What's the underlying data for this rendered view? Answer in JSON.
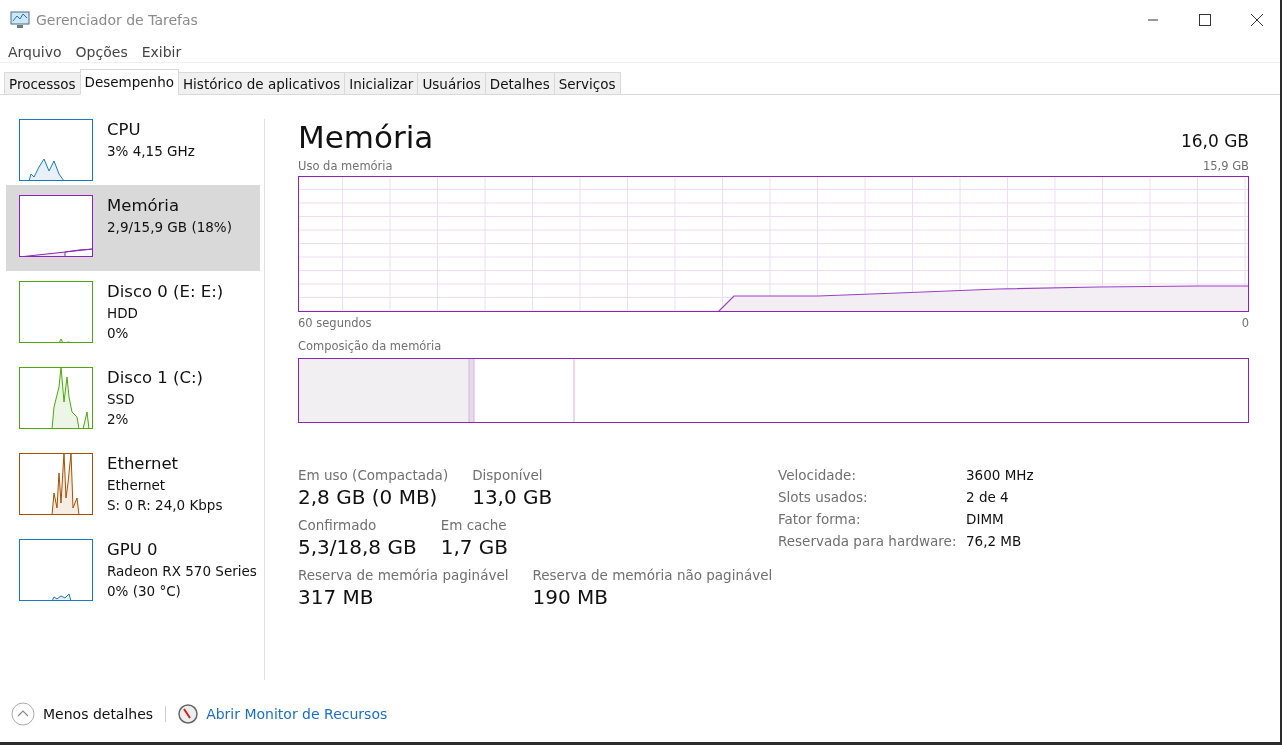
{
  "window": {
    "title": "Gerenciador de Tarefas"
  },
  "menu": [
    "Arquivo",
    "Opções",
    "Exibir"
  ],
  "tabs": [
    {
      "label": "Processos",
      "selected": false
    },
    {
      "label": "Desempenho",
      "selected": true
    },
    {
      "label": "Histórico de aplicativos",
      "selected": false
    },
    {
      "label": "Inicializar",
      "selected": false
    },
    {
      "label": "Usuários",
      "selected": false
    },
    {
      "label": "Detalhes",
      "selected": false
    },
    {
      "label": "Serviços",
      "selected": false
    }
  ],
  "sidebar": {
    "items": [
      {
        "name": "CPU",
        "lines": [
          "3% 4,15 GHz"
        ],
        "color": "#1a7abf",
        "selected": false
      },
      {
        "name": "Memória",
        "lines": [
          "2,9/15,9 GB (18%)"
        ],
        "color": "#8b25b8",
        "selected": true
      },
      {
        "name": "Disco 0 (E: E:)",
        "lines": [
          "HDD",
          "0%"
        ],
        "color": "#4ca80c",
        "selected": false
      },
      {
        "name": "Disco 1 (C:)",
        "lines": [
          "SSD",
          "2%"
        ],
        "color": "#4ca80c",
        "selected": false
      },
      {
        "name": "Ethernet",
        "lines": [
          "Ethernet",
          "S: 0 R: 24,0 Kbps"
        ],
        "color": "#a74f01",
        "selected": false
      },
      {
        "name": "GPU 0",
        "lines": [
          "Radeon RX 570 Series",
          "0%  (30 °C)"
        ],
        "color": "#1a7abf",
        "selected": false
      }
    ]
  },
  "main": {
    "title": "Memória",
    "total": "16,0 GB",
    "usage_graph": {
      "label": "Uso da memória",
      "max_label": "15,9 GB",
      "left_label": "60 segundos",
      "right_label": "0"
    },
    "composition": {
      "label": "Composição da memória"
    },
    "stats": [
      {
        "label": "Em uso (Compactada)",
        "value": "2,8 GB (0 MB)"
      },
      {
        "label": "Disponível",
        "value": "13,0 GB"
      },
      {
        "label": "Confirmado",
        "value": "5,3/18,8 GB"
      },
      {
        "label": "Em cache",
        "value": "1,7 GB"
      },
      {
        "label": "Reserva de memória paginável",
        "value": "317 MB"
      },
      {
        "label": "Reserva de memória não paginável",
        "value": "190 MB"
      }
    ],
    "details": [
      {
        "label": "Velocidade:",
        "value": "3600 MHz"
      },
      {
        "label": "Slots usados:",
        "value": "2 de 4"
      },
      {
        "label": "Fator forma:",
        "value": "DIMM"
      },
      {
        "label": "Reservada para hardware:",
        "value": "76,2 MB"
      }
    ]
  },
  "footer": {
    "less_details": "Menos detalhes",
    "monitor_link": "Abrir Monitor de Recursos"
  }
}
